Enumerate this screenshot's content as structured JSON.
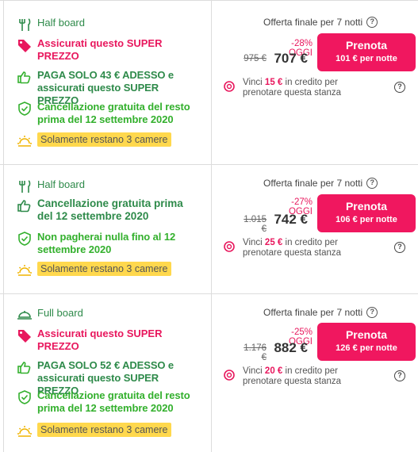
{
  "rooms": [
    {
      "board": "Half board",
      "features": [
        {
          "text": "Assicurati questo SUPER PREZZO"
        },
        {
          "text": "PAGA SOLO 43 € ADESSO e assicurati questo SUPER PREZZO"
        },
        {
          "text": "Cancellazione gratuita del resto prima del 12 settembre 2020"
        },
        {
          "text": "Solamente restano 3 camere"
        }
      ],
      "offer_label": "Offerta finale per 7 notti",
      "discount": "-28% OGGI",
      "old_price": "975 €",
      "price": "707 €",
      "button_label": "Prenota",
      "button_sub": "101 € per notte",
      "credit_prefix": "Vinci ",
      "credit_amount": "15 €",
      "credit_suffix": " in credito per prenotare questa stanza"
    },
    {
      "board": "Half board",
      "features": [
        {
          "text": "Cancellazione gratuita prima del 12 settembre 2020"
        },
        {
          "text": "Non pagherai nulla fino al 12 settembre 2020"
        },
        {
          "text": "Solamente restano 3 camere"
        }
      ],
      "offer_label": "Offerta finale per 7 notti",
      "discount": "-27% OGGI",
      "old_price": "1.015 €",
      "price": "742 €",
      "button_label": "Prenota",
      "button_sub": "106 € per notte",
      "credit_prefix": "Vinci ",
      "credit_amount": "25 €",
      "credit_suffix": " in credito per prenotare questa stanza"
    },
    {
      "board": "Full board",
      "features": [
        {
          "text": "Assicurati questo SUPER PREZZO"
        },
        {
          "text": "PAGA SOLO 52 € ADESSO e assicurati questo SUPER PREZZO"
        },
        {
          "text": "Cancellazione gratuita del resto prima del 12 settembre 2020"
        },
        {
          "text": "Solamente restano 3 camere"
        }
      ],
      "offer_label": "Offerta finale per 7 notti",
      "discount": "-25% OGGI",
      "old_price": "1.176 €",
      "price": "882 €",
      "button_label": "Prenota",
      "button_sub": "126 € per notte",
      "credit_prefix": "Vinci ",
      "credit_amount": "20 €",
      "credit_suffix": " in credito per prenotare questa stanza"
    }
  ],
  "colors": {
    "accent_pink": "#e8175d",
    "button_pink": "#f0175f",
    "green_dark": "#2e8a4a",
    "green_bright": "#33b02d",
    "badge_yellow": "#ffd84d"
  },
  "icons": {
    "board": "fork-knife-icon",
    "full_board": "cloche-icon",
    "tag": "tag-icon",
    "thumb": "thumbs-up-icon",
    "shield": "shield-check-icon",
    "sun": "sun-icon",
    "help": "question-circle-icon",
    "coin": "coin-icon"
  }
}
